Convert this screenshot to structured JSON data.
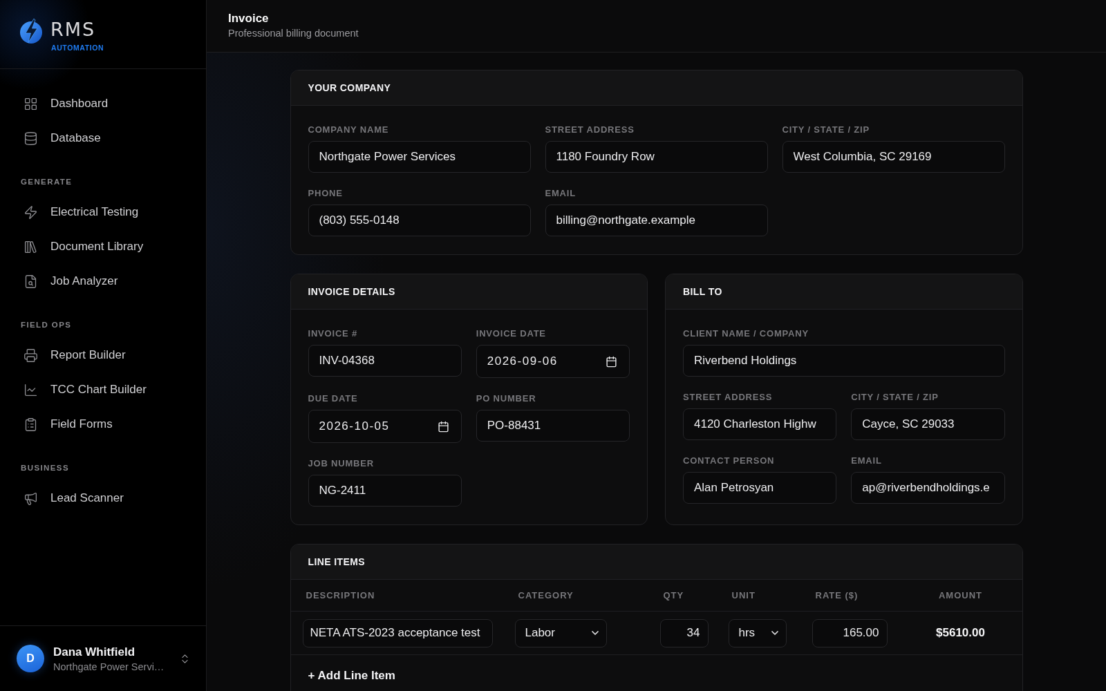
{
  "sidebar": {
    "logo": {
      "title": "RMS",
      "subtitle": "AUTOMATION"
    },
    "groups": [
      {
        "items": [
          {
            "label": "Dashboard",
            "selected": false
          },
          {
            "label": "Database",
            "selected": false
          }
        ]
      },
      {
        "heading": "GENERATE",
        "items": [
          {
            "label": "Electrical Testing",
            "selected": false
          },
          {
            "label": "Document Library",
            "selected": false
          },
          {
            "label": "Job Analyzer",
            "selected": false
          }
        ]
      },
      {
        "heading": "FIELD OPS",
        "items": [
          {
            "label": "Report Builder",
            "selected": false
          },
          {
            "label": "TCC Chart Builder",
            "selected": false
          },
          {
            "label": "Field Forms",
            "selected": false
          }
        ]
      },
      {
        "heading": "BUSINESS",
        "items": [
          {
            "label": "Lead Scanner",
            "selected": false
          }
        ]
      }
    ],
    "user": {
      "initial": "D",
      "name": "Dana Whitfield",
      "company": "Northgate Power Servi…"
    }
  },
  "header": {
    "title": "Invoice",
    "subtitle": "Professional billing document"
  },
  "your_company": {
    "title": "YOUR COMPANY",
    "fields": [
      {
        "label": "COMPANY NAME",
        "value": "Northgate Power Services",
        "kind": "text"
      },
      {
        "label": "STREET ADDRESS",
        "value": "1180 Foundry Row",
        "kind": "text"
      },
      {
        "label": "CITY / STATE / ZIP",
        "value": "West Columbia, SC 29169",
        "kind": "text"
      },
      {
        "label": "PHONE",
        "value": "(803) 555-0148",
        "kind": "text"
      },
      {
        "label": "EMAIL",
        "value": "billing@northgate.example",
        "kind": "text"
      }
    ]
  },
  "invoice_details": {
    "title": "INVOICE DETAILS",
    "fields": [
      {
        "label": "INVOICE #",
        "value": "INV-04368",
        "kind": "text"
      },
      {
        "label": "INVOICE DATE",
        "value": "2026-09-06",
        "kind": "date"
      },
      {
        "label": "DUE DATE",
        "value": "2026-10-05",
        "kind": "date"
      },
      {
        "label": "PO NUMBER",
        "value": "PO-88431",
        "kind": "text"
      },
      {
        "label": "JOB NUMBER",
        "value": "NG-2411",
        "kind": "text"
      }
    ]
  },
  "bill_to": {
    "title": "BILL TO",
    "fields": [
      {
        "label": "CLIENT NAME / COMPANY",
        "value": "Riverbend Holdings",
        "kind": "text"
      },
      {
        "label": "STREET ADDRESS",
        "value": "4120 Charleston Highw",
        "kind": "text"
      },
      {
        "label": "CITY / STATE / ZIP",
        "value": "Cayce, SC 29033",
        "kind": "text"
      },
      {
        "label": "CONTACT PERSON",
        "value": "Alan Petrosyan",
        "kind": "text"
      },
      {
        "label": "EMAIL",
        "value": "ap@riverbendholdings.e",
        "kind": "text"
      }
    ]
  },
  "line_items": {
    "title": "LINE ITEMS",
    "columns": [
      "DESCRIPTION",
      "CATEGORY",
      "QTY",
      "UNIT",
      "RATE ($)",
      "AMOUNT"
    ],
    "rows": [
      {
        "description": "NETA ATS-2023 acceptance test",
        "category": "Labor",
        "qty": "34",
        "unit": "hrs",
        "rate": "165.00",
        "amount": "$5610.00"
      }
    ],
    "add_button": "+ Add Line Item"
  }
}
